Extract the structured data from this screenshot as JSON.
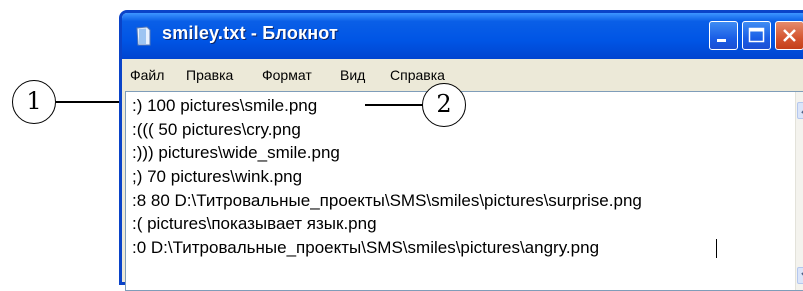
{
  "window": {
    "title": "smiley.txt - Блокнот"
  },
  "menu": [
    {
      "label": "Файл"
    },
    {
      "label": "Правка"
    },
    {
      "label": "Формат"
    },
    {
      "label": "Вид"
    },
    {
      "label": "Справка"
    }
  ],
  "editor": {
    "lines": [
      ":) 100 pictures\\smile.png",
      ":((( 50 pictures\\cry.png",
      ":))) pictures\\wide_smile.png",
      ";) 70 pictures\\wink.png",
      ":8 80 D:\\Титровальные_проекты\\SMS\\smiles\\pictures\\surprise.png",
      ":( pictures\\показывает язык.png",
      ":0 D:\\Титровальные_проекты\\SMS\\smiles\\pictures\\angry.png"
    ]
  },
  "callouts": [
    {
      "label": "1"
    },
    {
      "label": "2"
    }
  ],
  "icons": {
    "app": "notepad-icon",
    "minimize": "minimize-icon",
    "maximize": "maximize-icon",
    "close": "close-icon",
    "scroll_up": "scroll-up-arrow-icon",
    "scroll_down": "scroll-down-arrow-icon"
  },
  "colors": {
    "titlebar": "#0055e5",
    "close_button": "#d45530"
  }
}
